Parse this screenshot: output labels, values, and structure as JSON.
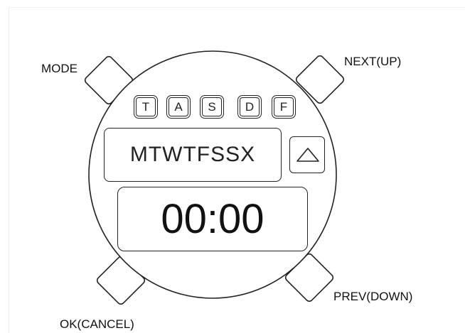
{
  "buttons": {
    "mode": "MODE",
    "next_up": "NEXT(UP)",
    "ok_cancel": "OK(CANCEL)",
    "prev_down": "PREV(DOWN)"
  },
  "indicators": [
    "T",
    "A",
    "S",
    "D",
    "F"
  ],
  "weekday_row": "MTWTFSSX",
  "up_icon": "triangle-up-icon",
  "time": "00:00",
  "colors": {
    "stroke": "#222222",
    "background": "#ffffff"
  }
}
